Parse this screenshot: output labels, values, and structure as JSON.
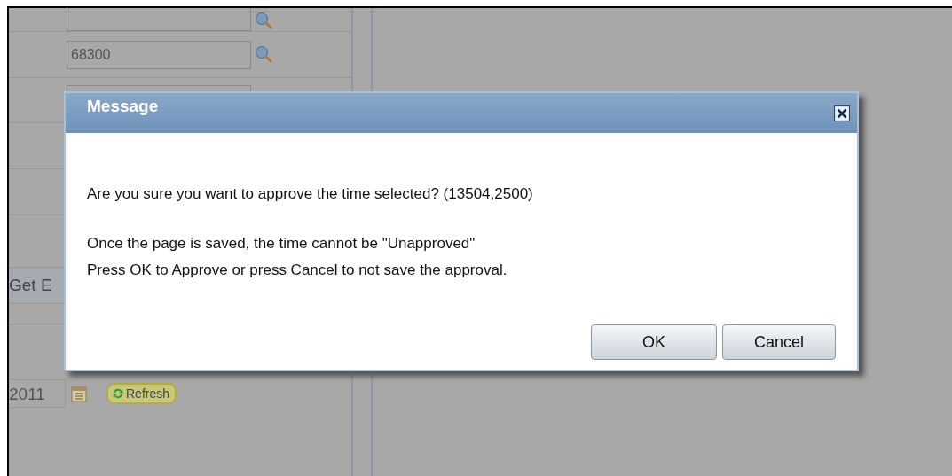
{
  "background_form": {
    "lookup_value": "68300",
    "button_label": "Get E",
    "date_value": "2011",
    "refresh_label": "Refresh"
  },
  "dialog": {
    "title": "Message",
    "lines": [
      "Are you sure you want to approve the time selected? (13504,2500)",
      "Once the page is saved,  the time cannot be \"Unapproved\"",
      "Press OK to Approve or press Cancel to not save the approval."
    ],
    "buttons": [
      "OK",
      "Cancel"
    ]
  }
}
